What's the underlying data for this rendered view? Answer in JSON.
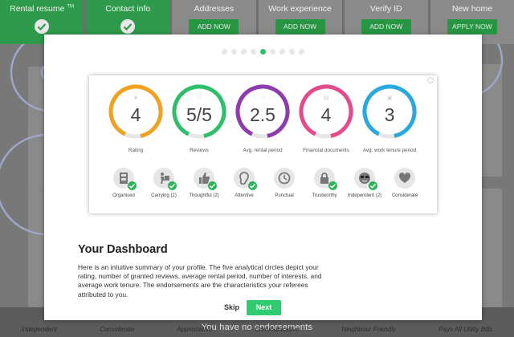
{
  "steps": [
    {
      "label": "Rental resume",
      "sup": "TM",
      "status": "done"
    },
    {
      "label": "Contact info",
      "status": "done"
    },
    {
      "label": "Addresses",
      "button": "ADD NOW"
    },
    {
      "label": "Work experience",
      "button": "ADD NOW"
    },
    {
      "label": "Verify ID",
      "button": "ADD NOW"
    },
    {
      "label": "New home",
      "button": "APPLY NOW"
    }
  ],
  "background": {
    "no_endorsements": "You have no endorsements",
    "footer_items": [
      "Independent",
      "Considerate",
      "Appreciative",
      "Communicative",
      "Neighbour Friendly",
      "Pays All Utility Bills"
    ]
  },
  "modal": {
    "pager": {
      "count": 9,
      "active_index": 4
    },
    "preview": {
      "circles": [
        {
          "value": "4",
          "label": "Rating",
          "icon": "star-icon",
          "color": "#f0a11f"
        },
        {
          "value": "5/5",
          "label": "Reviews",
          "icon": "chat-icon",
          "color": "#2fbf6b"
        },
        {
          "value": "2.5",
          "label": "Avg. rental period",
          "icon": "home-icon",
          "color": "#8e3bb0"
        },
        {
          "value": "4",
          "label": "Financial documents",
          "icon": "document-icon",
          "color": "#e34b8c"
        },
        {
          "value": "3",
          "label": "Avg. work tenure period",
          "icon": "briefcase-icon",
          "color": "#2aa9e0"
        }
      ],
      "badges": [
        {
          "label": "Organised",
          "icon": "organised-icon",
          "checked": true
        },
        {
          "label": "Carrying (2)",
          "icon": "carrying-icon",
          "checked": true
        },
        {
          "label": "Thoughtful (2)",
          "icon": "thumbs-up-icon",
          "checked": true
        },
        {
          "label": "Attentive",
          "icon": "ear-icon",
          "checked": true
        },
        {
          "label": "Punctual",
          "icon": "clock-icon",
          "checked": false
        },
        {
          "label": "Trustworthy",
          "icon": "lock-icon",
          "checked": true
        },
        {
          "label": "Independent (2)",
          "icon": "sunglasses-icon",
          "checked": true
        },
        {
          "label": "Considerate",
          "icon": "heart-icon",
          "checked": false
        }
      ]
    },
    "title": "Your Dashboard",
    "description": "Here is an intuitive summary of your profile. The five analytical circles depict your rating, number of granted reviews, average rental period, number of interests, and average work tenure. The endorsements are the characteristics your referees attributed to you.",
    "skip_label": "Skip",
    "next_label": "Next"
  }
}
